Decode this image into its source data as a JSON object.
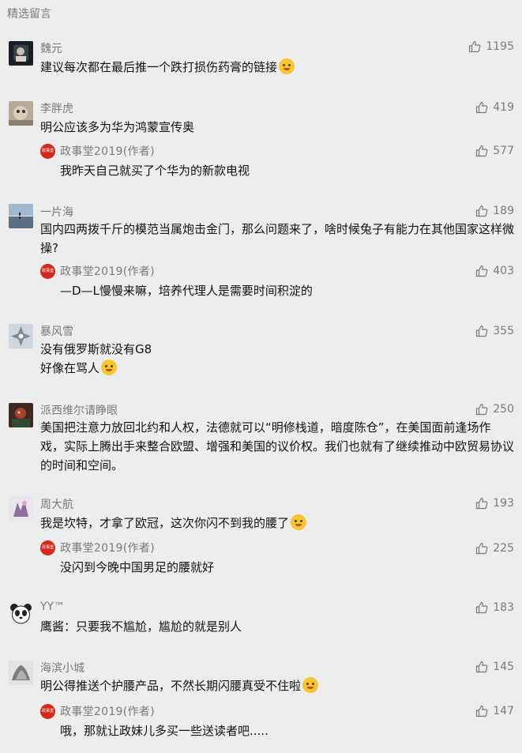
{
  "section_title": "精选留言",
  "comments": [
    {
      "nickname": "魏元",
      "likes": "1195",
      "text": "建议每次都在最后推一个跌打损伤药膏的链接",
      "emoji": "smirk-emoji"
    },
    {
      "nickname": "李胖虎",
      "likes": "419",
      "text": "明公应该多为华为鸿蒙宣传奥",
      "reply": {
        "nickname": "政事堂2019(作者)",
        "likes": "577",
        "text": "我昨天自己就买了个华为的新款电视"
      }
    },
    {
      "nickname": "一片海",
      "likes": "189",
      "text": "国内四两拨千斤的模范当属炮击金门，那么问题来了，啥时候兔子有能力在其他国家这样微操?",
      "reply": {
        "nickname": "政事堂2019(作者)",
        "likes": "403",
        "text": "—D—L慢慢来嘛，培养代理人是需要时间积淀的"
      }
    },
    {
      "nickname": "暴风雪",
      "likes": "355",
      "text": "没有俄罗斯就没有G8",
      "text2": "好像在骂人",
      "emoji": "facepalm-emoji"
    },
    {
      "nickname": "派西维尔请睁眼",
      "likes": "250",
      "text": "美国把注意力放回北约和人权，法德就可以“明修栈道，暗度陈仓”，在美国面前逢场作戏，实际上腾出手来整合欧盟、增强和美国的议价权。我们也就有了继续推动中欧贸易协议的时间和空间。"
    },
    {
      "nickname": "周大航",
      "likes": "193",
      "text": "我是坎特，才拿了欧冠，这次你闪不到我的腰了",
      "emoji": "grin-emoji",
      "reply": {
        "nickname": "政事堂2019(作者)",
        "likes": "225",
        "text": "没闪到今晚中国男足的腰就好"
      }
    },
    {
      "nickname": "YY™",
      "likes": "183",
      "text": "鹰酱：只要我不尴尬，尴尬的就是别人"
    },
    {
      "nickname": "海滨小城",
      "likes": "145",
      "text": "明公得推送个护腰产品，不然长期闪腰真受不住啦",
      "emoji": "shy-emoji",
      "reply": {
        "nickname": "政事堂2019(作者)",
        "likes": "147",
        "text": "哦，那就让政妹儿多买一些送读者吧....."
      }
    }
  ],
  "reply_logo_text": "政事堂"
}
